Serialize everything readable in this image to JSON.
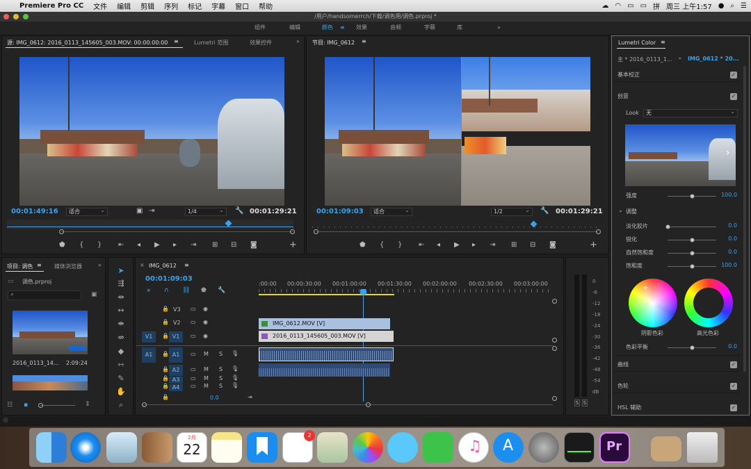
{
  "menubar": {
    "app": "Premiere Pro CC",
    "items": [
      "文件",
      "编辑",
      "剪辑",
      "序列",
      "标记",
      "字幕",
      "窗口",
      "帮助"
    ],
    "clock": "周三 上午1:57"
  },
  "title": "/用户/handsomerrch/下载/调色用/调色.prproj *",
  "workspaces": [
    "组件",
    "编辑",
    "颜色",
    "效果",
    "音频",
    "字幕",
    "库"
  ],
  "source": {
    "tab": "源: IMG_0612: 2016_0113_145605_003.MOV: 00:00:00:00",
    "tab2": "Lumetri 范围",
    "tab3": "效果控件",
    "timecode": "00:01:49:16",
    "fit": "适合",
    "res": "1/4",
    "duration": "00:01:29:21"
  },
  "program": {
    "tab": "节目: IMG_0612",
    "timecode": "00:01:09:03",
    "fit": "适合",
    "res": "1/2",
    "duration": "00:01:29:21"
  },
  "project": {
    "tab": "项目: 调色",
    "tab2": "媒体浏览器",
    "file": "调色.prproj",
    "clips": [
      {
        "name": "2016_0113_14...",
        "duration": "2:09:24"
      }
    ]
  },
  "timeline": {
    "tab": "IMG_0612",
    "timecode": "00:01:09:03",
    "ruler": [
      ":00:00",
      "00:00:30:00",
      "00:01:00:00",
      "00:01:30:00",
      "00:02:00:00",
      "00:02:30:00",
      "00:03:00:00"
    ],
    "video_tracks": [
      "V3",
      "V2",
      "V1"
    ],
    "audio_tracks": [
      "A1",
      "A2",
      "A3",
      "A4"
    ],
    "src_v": "V1",
    "src_a": "A1",
    "clip_v2": "IMG_0612.MOV [V]",
    "clip_v1": "2016_0113_145605_003.MOV [V]",
    "master_val": "0.0"
  },
  "meter": {
    "labels": [
      "0",
      "-6",
      "-12",
      "-18",
      "-24",
      "-30",
      "-36",
      "-42",
      "-48",
      "-54",
      "dB"
    ],
    "solo": [
      "S",
      "S"
    ]
  },
  "lumetri": {
    "title": "Lumetri Color",
    "master": "主 * 2016_0113_1...",
    "seq": "IMG_0612 * 20...",
    "basic": "基本校正",
    "creative": "创意",
    "look_label": "Look",
    "look_value": "无",
    "intensity_label": "强度",
    "intensity": "100.0",
    "adjust": "调整",
    "sliders": [
      {
        "label": "淡化胶片",
        "value": "0.0",
        "pos": 0.0
      },
      {
        "label": "锐化",
        "value": "0.0",
        "pos": 0.5
      },
      {
        "label": "自然饱和度",
        "value": "0.0",
        "pos": 0.5
      },
      {
        "label": "饱和度",
        "value": "100.0",
        "pos": 0.5
      }
    ],
    "shadow_tint": "阴影色彩",
    "highlight_tint": "高光色彩",
    "balance_label": "色彩平衡",
    "balance": "0.0",
    "curves": "曲线",
    "wheels": "色轮",
    "hsl": "HSL 辅助"
  },
  "dock": {
    "calendar_month": "2月",
    "calendar_day": "22",
    "reminder_badge": "2",
    "premiere": "Pr"
  }
}
